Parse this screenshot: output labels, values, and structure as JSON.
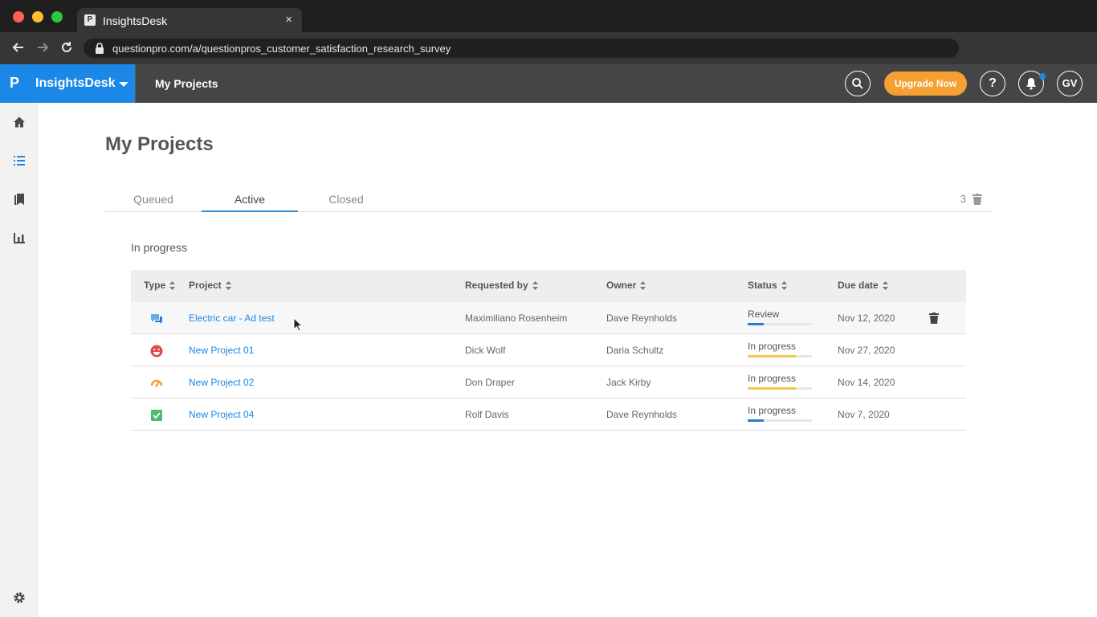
{
  "browser": {
    "tab_title": "InsightsDesk",
    "tab_favicon_letter": "P",
    "tab_close": "×",
    "url": "questionpro.com/a/questionpros_customer_satisfaction_research_survey",
    "icons": [
      "back-arrow-icon",
      "forward-arrow-icon",
      "reload-icon",
      "lock-icon"
    ]
  },
  "header": {
    "brand_logo": "P",
    "brand_name": "InsightsDesk",
    "title": "My Projects",
    "upgrade_label": "Upgrade Now",
    "help_label": "?",
    "avatar_initials": "GV",
    "brand_color": "#1b87e6",
    "upgrade_color": "#f5a033"
  },
  "sidebar": {
    "items": [
      {
        "icon": "home-icon",
        "active": false
      },
      {
        "icon": "list-icon",
        "active": true
      },
      {
        "icon": "bookmarks-icon",
        "active": false
      },
      {
        "icon": "bar-chart-icon",
        "active": false
      }
    ],
    "bottom_icon": "settings-gear-icon"
  },
  "main": {
    "page_title": "My Projects",
    "tabs": [
      {
        "label": "Queued",
        "active": false
      },
      {
        "label": "Active",
        "active": true
      },
      {
        "label": "Closed",
        "active": false
      }
    ],
    "trash_count": "3",
    "section_label": "In progress",
    "columns": [
      "Type",
      "Project",
      "Requested by",
      "Owner",
      "Status",
      "Due date"
    ],
    "rows": [
      {
        "type_icon": "chat-bubbles-icon",
        "project": "Electric car - Ad test",
        "requested_by": "Maximiliano Rosenheim",
        "owner": "Dave Reynholds",
        "status": "Review",
        "progress": 0.25,
        "progress_color": "#2a7bd4",
        "due": "Nov 12, 2020",
        "hovered": true
      },
      {
        "type_icon": "smiley-face-icon",
        "project": "New Project 01",
        "requested_by": "Dick Wolf",
        "owner": "Daria Schultz",
        "status": "In progress",
        "progress": 0.75,
        "progress_color": "#f2c94c",
        "due": "Nov 27, 2020",
        "hovered": false
      },
      {
        "type_icon": "gauge-icon",
        "project": "New Project 02",
        "requested_by": "Don Draper",
        "owner": "Jack Kirby",
        "status": "In progress",
        "progress": 0.75,
        "progress_color": "#f2c94c",
        "due": "Nov 14, 2020",
        "hovered": false
      },
      {
        "type_icon": "checkbox-icon",
        "project": "New Project 04",
        "requested_by": "Rolf Davis",
        "owner": "Dave Reynholds",
        "status": "In progress",
        "progress": 0.25,
        "progress_color": "#2a7bd4",
        "due": "Nov 7, 2020",
        "hovered": false
      }
    ]
  }
}
